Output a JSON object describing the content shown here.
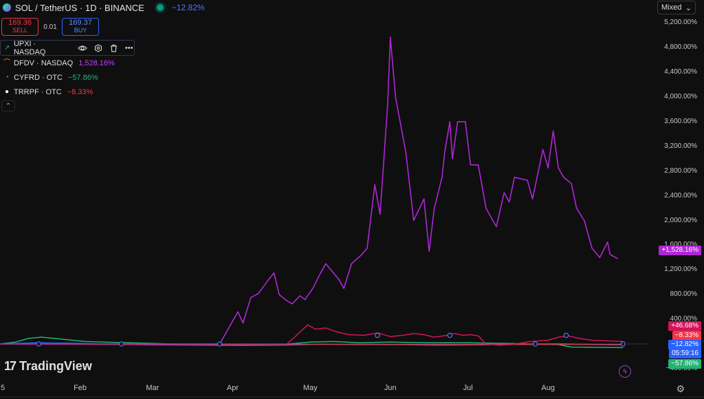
{
  "header": {
    "title": "SOL / TetherUS · 1D · BINANCE",
    "change": "−12.82%",
    "sell_price": "169.36",
    "sell_label": "SELL",
    "spread": "0.01",
    "buy_price": "169.37",
    "buy_label": "BUY",
    "mode": "Mixed"
  },
  "legend": [
    {
      "name": "UPXI · NASDAQ",
      "value": "",
      "icon": "upxi-logo-icon",
      "color": "#22b573"
    },
    {
      "name": "DFDV · NASDAQ",
      "value": "1,528.16%",
      "icon": "dfdv-logo-icon",
      "color": "#b026d8"
    },
    {
      "name": "CYFRD · OTC",
      "value": "−57.86%",
      "icon": "cyfrd-logo-icon",
      "color": "#22b573"
    },
    {
      "name": "TRRPF · OTC",
      "value": "−8.33%",
      "icon": "trrpf-logo-icon",
      "color": "#f23645"
    }
  ],
  "badges": {
    "dfdv": "+1,528.16%",
    "upxi": "+46.68%",
    "trrpf": "−8.33%",
    "sol": "−12.82%",
    "countdown": "05:59:16",
    "cyfrd": "−57.86%"
  },
  "watermark": "TradingView",
  "chart_data": {
    "type": "line",
    "y_ticks": [
      "5,200.00%",
      "4,800.00%",
      "4,400.00%",
      "4,000.00%",
      "3,600.00%",
      "3,200.00%",
      "2,800.00%",
      "2,400.00%",
      "2,000.00%",
      "1,600.00%",
      "1,200.00%",
      "800.00%",
      "400.00%",
      "−400.00%"
    ],
    "x_ticks": [
      "5",
      "Feb",
      "Mar",
      "Apr",
      "May",
      "Jun",
      "Jul",
      "Aug"
    ],
    "ylim": [
      -450,
      5300
    ],
    "scale": "percent",
    "colors": {
      "DFDV": "#b026d8",
      "UPXI": "#d2145a",
      "CYFRD": "#22b573",
      "SOL": "#2962ff",
      "TRRPF": "#f23645"
    },
    "series": [
      {
        "name": "DFDV",
        "points": [
          [
            "2025-01-01",
            0
          ],
          [
            "2025-03-27",
            0
          ],
          [
            "2025-04-03",
            520
          ],
          [
            "2025-04-05",
            340
          ],
          [
            "2025-04-08",
            750
          ],
          [
            "2025-04-11",
            820
          ],
          [
            "2025-04-15",
            1050
          ],
          [
            "2025-04-17",
            1150
          ],
          [
            "2025-04-19",
            800
          ],
          [
            "2025-04-22",
            700
          ],
          [
            "2025-04-24",
            650
          ],
          [
            "2025-04-27",
            780
          ],
          [
            "2025-04-29",
            720
          ],
          [
            "2025-05-02",
            900
          ],
          [
            "2025-05-05",
            1150
          ],
          [
            "2025-05-07",
            1300
          ],
          [
            "2025-05-09",
            1200
          ],
          [
            "2025-05-12",
            1050
          ],
          [
            "2025-05-14",
            900
          ],
          [
            "2025-05-17",
            1300
          ],
          [
            "2025-05-21",
            1450
          ],
          [
            "2025-05-23",
            1550
          ],
          [
            "2025-05-26",
            2580
          ],
          [
            "2025-05-28",
            2100
          ],
          [
            "2025-05-31",
            3900
          ],
          [
            "2025-06-01",
            4970
          ],
          [
            "2025-06-03",
            4000
          ],
          [
            "2025-06-07",
            3100
          ],
          [
            "2025-06-10",
            2000
          ],
          [
            "2025-06-14",
            2350
          ],
          [
            "2025-06-16",
            1500
          ],
          [
            "2025-06-18",
            2200
          ],
          [
            "2025-06-21",
            2700
          ],
          [
            "2025-06-22",
            3100
          ],
          [
            "2025-06-24",
            3600
          ],
          [
            "2025-06-25",
            3000
          ],
          [
            "2025-06-27",
            3600
          ],
          [
            "2025-06-30",
            3600
          ],
          [
            "2025-07-02",
            2900
          ],
          [
            "2025-07-05",
            2900
          ],
          [
            "2025-07-08",
            2200
          ],
          [
            "2025-07-12",
            1900
          ],
          [
            "2025-07-15",
            2450
          ],
          [
            "2025-07-17",
            2300
          ],
          [
            "2025-07-19",
            2700
          ],
          [
            "2025-07-24",
            2650
          ],
          [
            "2025-07-26",
            2350
          ],
          [
            "2025-07-30",
            3150
          ],
          [
            "2025-08-01",
            2850
          ],
          [
            "2025-08-03",
            3450
          ],
          [
            "2025-08-05",
            2850
          ],
          [
            "2025-08-07",
            2700
          ],
          [
            "2025-08-10",
            2600
          ],
          [
            "2025-08-12",
            2200
          ],
          [
            "2025-08-15",
            2000
          ],
          [
            "2025-08-18",
            1550
          ],
          [
            "2025-08-21",
            1400
          ],
          [
            "2025-08-24",
            1650
          ],
          [
            "2025-08-25",
            1450
          ],
          [
            "2025-08-28",
            1380
          ]
        ]
      },
      {
        "name": "UPXI",
        "points": [
          [
            "2025-01-01",
            0
          ],
          [
            "2025-04-22",
            0
          ],
          [
            "2025-04-26",
            150
          ],
          [
            "2025-04-30",
            310
          ],
          [
            "2025-05-03",
            240
          ],
          [
            "2025-05-07",
            260
          ],
          [
            "2025-05-11",
            200
          ],
          [
            "2025-05-16",
            150
          ],
          [
            "2025-05-22",
            140
          ],
          [
            "2025-05-27",
            180
          ],
          [
            "2025-06-01",
            120
          ],
          [
            "2025-06-06",
            140
          ],
          [
            "2025-06-10",
            170
          ],
          [
            "2025-06-14",
            150
          ],
          [
            "2025-06-18",
            110
          ],
          [
            "2025-06-23",
            140
          ],
          [
            "2025-06-26",
            170
          ],
          [
            "2025-06-29",
            140
          ],
          [
            "2025-07-02",
            150
          ],
          [
            "2025-07-05",
            130
          ],
          [
            "2025-07-08",
            0
          ],
          [
            "2025-07-13",
            -20
          ],
          [
            "2025-07-18",
            -10
          ],
          [
            "2025-07-25",
            40
          ],
          [
            "2025-08-01",
            60
          ],
          [
            "2025-08-05",
            110
          ],
          [
            "2025-08-09",
            130
          ],
          [
            "2025-08-13",
            90
          ],
          [
            "2025-08-18",
            60
          ],
          [
            "2025-08-24",
            50
          ],
          [
            "2025-08-30",
            40
          ]
        ]
      },
      {
        "name": "CYFRD",
        "points": [
          [
            "2025-01-01",
            0
          ],
          [
            "2025-01-07",
            30
          ],
          [
            "2025-01-12",
            90
          ],
          [
            "2025-01-17",
            110
          ],
          [
            "2025-01-22",
            90
          ],
          [
            "2025-01-27",
            70
          ],
          [
            "2025-02-03",
            40
          ],
          [
            "2025-02-10",
            30
          ],
          [
            "2025-02-20",
            20
          ],
          [
            "2025-03-01",
            10
          ],
          [
            "2025-03-15",
            -10
          ],
          [
            "2025-04-01",
            -20
          ],
          [
            "2025-04-20",
            -10
          ],
          [
            "2025-05-01",
            30
          ],
          [
            "2025-05-10",
            40
          ],
          [
            "2025-05-20",
            20
          ],
          [
            "2025-06-01",
            30
          ],
          [
            "2025-06-15",
            20
          ],
          [
            "2025-07-01",
            20
          ],
          [
            "2025-07-15",
            10
          ],
          [
            "2025-07-25",
            0
          ],
          [
            "2025-08-05",
            -10
          ],
          [
            "2025-08-10",
            -50
          ],
          [
            "2025-08-20",
            -55
          ],
          [
            "2025-08-30",
            -58
          ]
        ]
      },
      {
        "name": "SOL",
        "points": [
          [
            "2025-01-01",
            0
          ],
          [
            "2025-01-15",
            20
          ],
          [
            "2025-02-01",
            10
          ],
          [
            "2025-02-15",
            -5
          ],
          [
            "2025-03-01",
            -15
          ],
          [
            "2025-03-20",
            -20
          ],
          [
            "2025-04-05",
            -25
          ],
          [
            "2025-04-20",
            -20
          ],
          [
            "2025-05-05",
            -5
          ],
          [
            "2025-05-20",
            -10
          ],
          [
            "2025-06-05",
            -10
          ],
          [
            "2025-06-20",
            -20
          ],
          [
            "2025-07-05",
            -15
          ],
          [
            "2025-07-20",
            -5
          ],
          [
            "2025-08-05",
            5
          ],
          [
            "2025-08-20",
            -10
          ],
          [
            "2025-08-30",
            -13
          ]
        ]
      },
      {
        "name": "TRRPF",
        "points": [
          [
            "2025-01-01",
            0
          ],
          [
            "2025-02-01",
            -5
          ],
          [
            "2025-03-01",
            -10
          ],
          [
            "2025-04-01",
            -8
          ],
          [
            "2025-05-01",
            -5
          ],
          [
            "2025-06-01",
            -7
          ],
          [
            "2025-07-01",
            -10
          ],
          [
            "2025-08-01",
            -6
          ],
          [
            "2025-08-30",
            -8
          ]
        ]
      }
    ]
  }
}
